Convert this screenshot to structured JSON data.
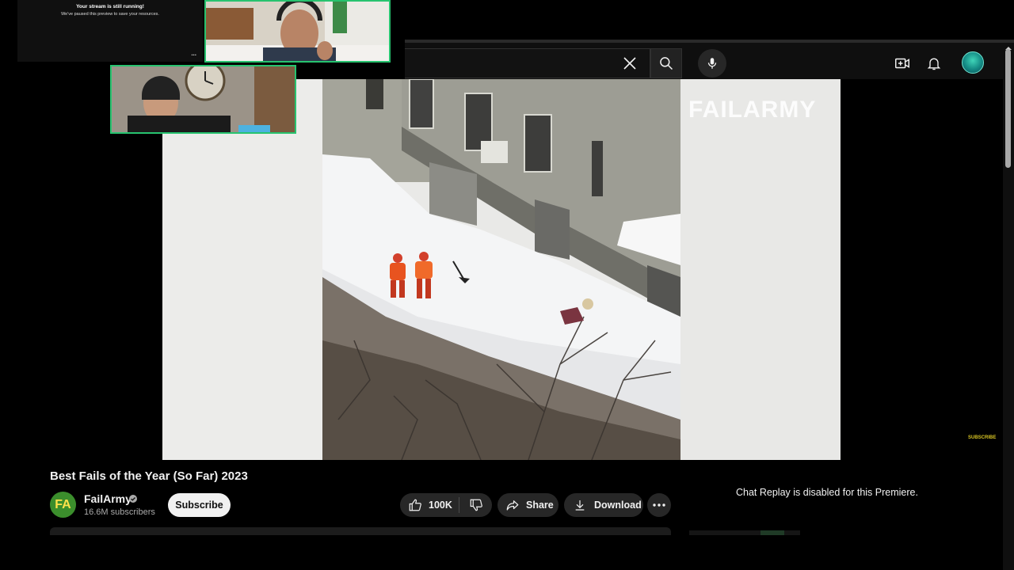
{
  "overlay": {
    "title": "Your stream is still running!",
    "message": "We've paused this preview to save your resources.",
    "menu": "..."
  },
  "header": {
    "search_value": "",
    "icons": [
      "close-icon",
      "search-icon",
      "mic-icon",
      "create-icon",
      "bell-icon",
      "avatar"
    ]
  },
  "player": {
    "watermark": "FAILARMY",
    "subscribe_mark": "SUBSCRIBE"
  },
  "video": {
    "title": "Best Fails of the Year (So Far) 2023"
  },
  "channel": {
    "avatar_text": "FA",
    "name": "FailArmy",
    "subscribers": "16.6M subscribers",
    "subscribe_label": "Subscribe"
  },
  "actions": {
    "like_count": "100K",
    "share_label": "Share",
    "download_label": "Download"
  },
  "chat": {
    "replay_message": "Chat Replay is disabled for this Premiere."
  },
  "colors": {
    "background": "#000000",
    "header": "#0f0f0f",
    "pill": "#272727",
    "webcam_border": "#27c36f",
    "subscribe_btn": "#f1f1f1"
  }
}
